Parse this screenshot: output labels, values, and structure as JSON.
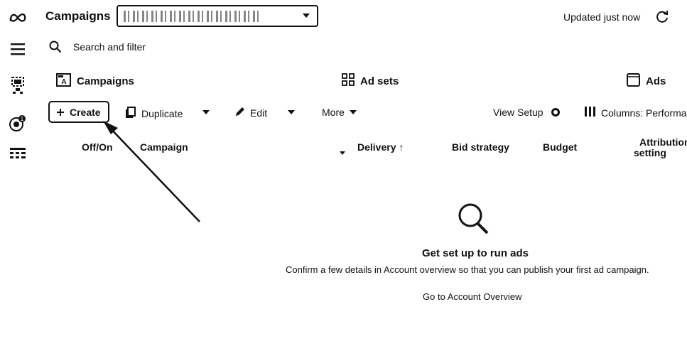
{
  "header": {
    "title": "Campaigns",
    "updated_text": "Updated just now"
  },
  "search": {
    "placeholder": "Search and filter"
  },
  "levels": [
    {
      "label": "Campaigns"
    },
    {
      "label": "Ad sets"
    },
    {
      "label": "Ads"
    }
  ],
  "toolbar": {
    "create_label": "Create",
    "duplicate_label": "Duplicate",
    "edit_label": "Edit",
    "more_label": "More",
    "view_setup_label": "View Setup",
    "columns_label": "Columns: Performar"
  },
  "table": {
    "columns": [
      "Off/On",
      "Campaign",
      "Delivery ↑",
      "Bid strategy",
      "Budget",
      "Attribution",
      "setting"
    ]
  },
  "empty_state": {
    "title": "Get set up to run ads",
    "description": "Confirm a few details in Account overview so that you can publish your first ad campaign.",
    "link": "Go to Account Overview"
  },
  "icons": {
    "logo": "meta-logo-icon",
    "menu": "hamburger-menu-icon",
    "search": "search-icon",
    "refresh": "refresh-icon"
  }
}
